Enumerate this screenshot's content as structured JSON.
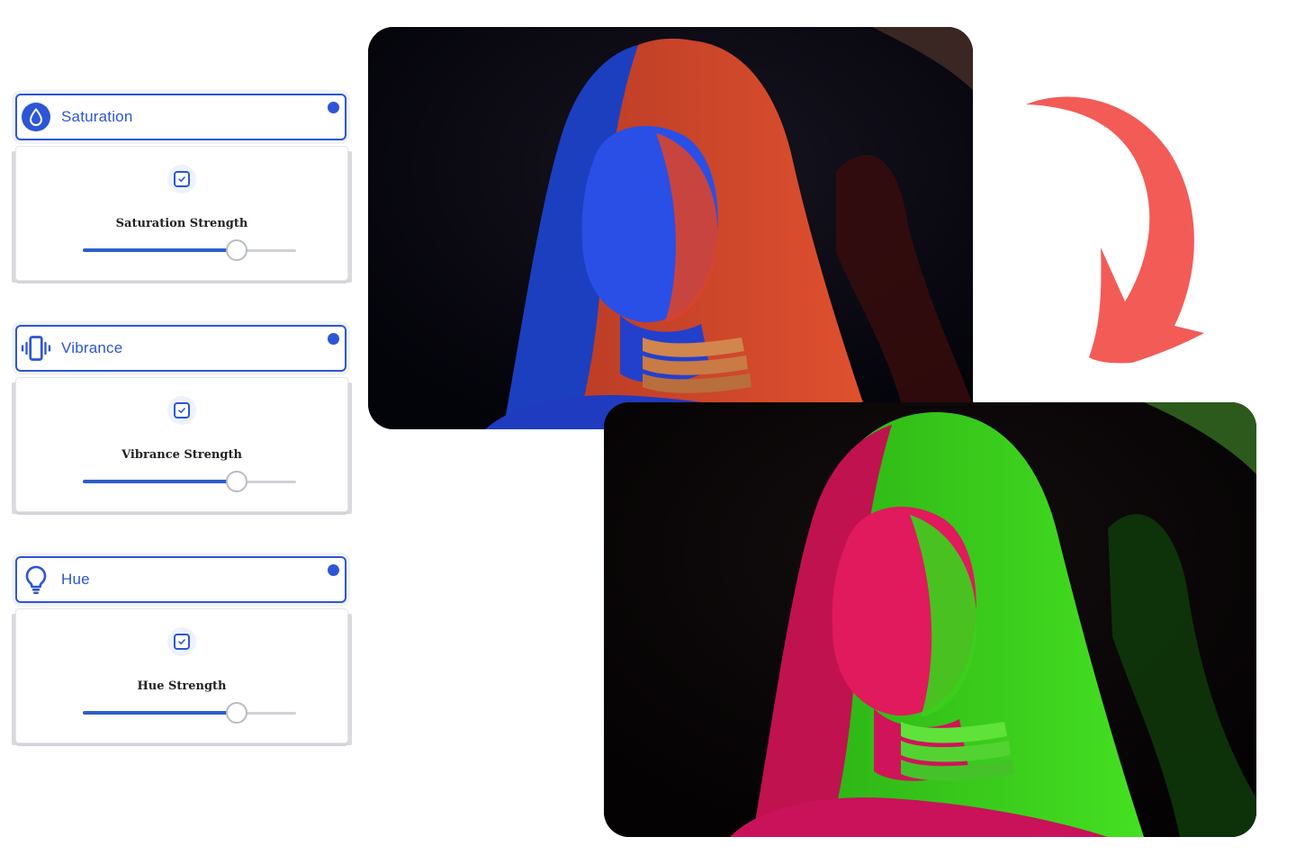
{
  "panels": [
    {
      "id": "saturation",
      "title": "Saturation",
      "strength_label": "Saturation Strength",
      "value": 0.72,
      "icon": "droplet-icon"
    },
    {
      "id": "vibrance",
      "title": "Vibrance",
      "strength_label": "Vibrance Strength",
      "value": 0.72,
      "icon": "vibrate-phone-icon"
    },
    {
      "id": "hue",
      "title": "Hue",
      "strength_label": "Hue Strength",
      "value": 0.72,
      "icon": "lightbulb-icon"
    }
  ],
  "colors": {
    "accent": "#2d55d6",
    "slider_fill": "#2d5fc9",
    "arrow": "#f35b57",
    "before_tones": [
      "#1a3ddc",
      "#e04a2e"
    ],
    "after_tones": [
      "#e0165a",
      "#36d61a"
    ]
  }
}
